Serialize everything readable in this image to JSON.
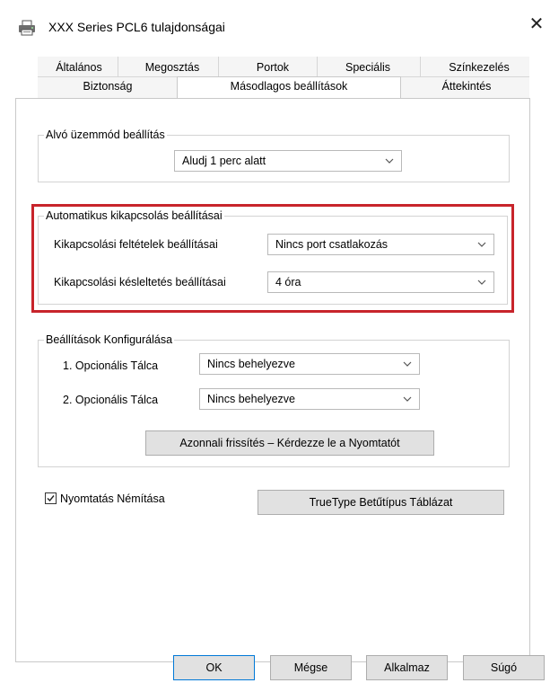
{
  "window": {
    "title": "XXX Series PCL6 tulajdonságai",
    "close_glyph": "✕"
  },
  "tabs_row1": [
    "Általános",
    "Megosztás",
    "Portok",
    "Speciális",
    "Színkezelés"
  ],
  "tabs_row2": [
    "Biztonság",
    "Másodlagos beállítások",
    "Áttekintés"
  ],
  "active_tab": "Másodlagos beállítások",
  "sleep_group": {
    "legend": "Alvó üzemmód beállítás",
    "combo_value": "Aludj 1 perc alatt"
  },
  "auto_off_group": {
    "legend": "Automatikus kikapcsolás beállításai",
    "condition_label": "Kikapcsolási feltételek beállításai",
    "condition_value": "Nincs port csatlakozás",
    "delay_label": "Kikapcsolási késleltetés beállításai",
    "delay_value": "4 óra",
    "highlight_color": "#c8242b"
  },
  "config_group": {
    "legend": "Beállítások Konfigurálása",
    "tray1_label": "1. Opcionális Tálca",
    "tray1_value": "Nincs behelyezve",
    "tray2_label": "2. Opcionális Tálca",
    "tray2_value": "Nincs behelyezve",
    "refresh_button": "Azonnali frissítés – Kérdezze le a Nyomtatót"
  },
  "mute_print": {
    "label": "Nyomtatás Némítása",
    "checked": true
  },
  "truetype_button": "TrueType Betűtípus Táblázat",
  "footer": {
    "ok": "OK",
    "cancel": "Mégse",
    "apply": "Alkalmaz",
    "help": "Súgó"
  }
}
